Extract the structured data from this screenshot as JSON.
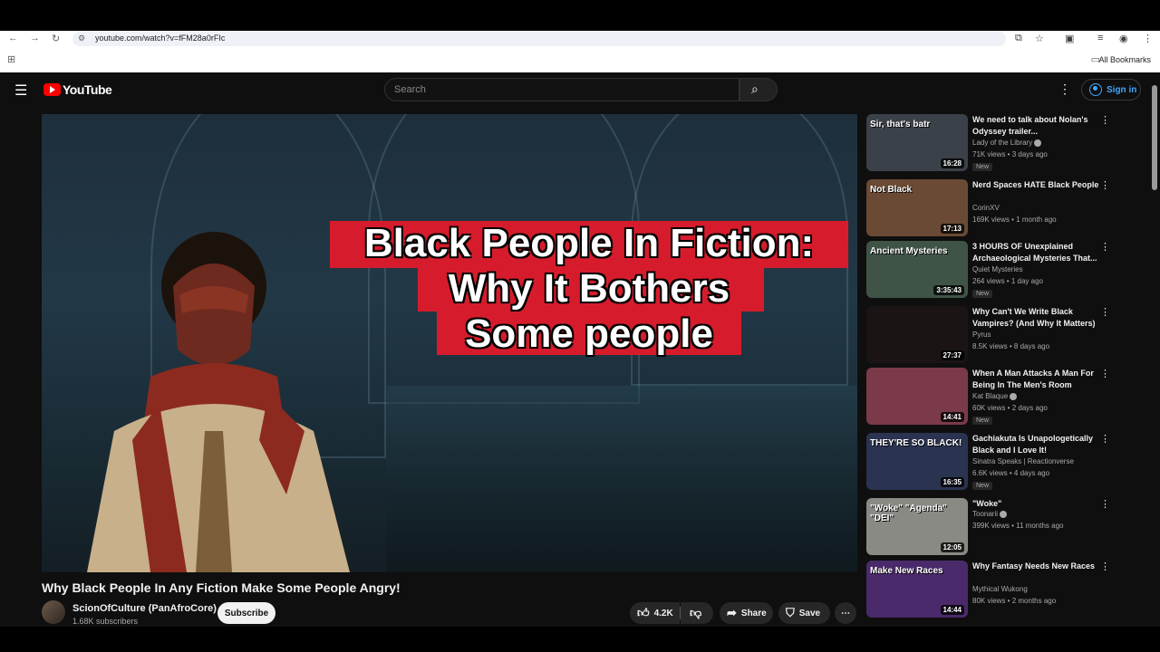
{
  "browser": {
    "url": "youtube.com/watch?v=fFM28a0rFIc",
    "all_bookmarks": "All Bookmarks"
  },
  "header": {
    "logo_text": "YouTube",
    "search_placeholder": "Search",
    "sign_in": "Sign in"
  },
  "player": {
    "title_line1": "Black People In Fiction:",
    "title_line2": "Why It Bothers",
    "title_line3": "Some people"
  },
  "video": {
    "title": "Why Black People In Any Fiction Make Some People Angry!",
    "channel": "ScionOfCulture (PanAfroCore)",
    "subscribers": "1.68K subscribers",
    "subscribe": "Subscribe",
    "likes": "4.2K",
    "share": "Share",
    "save": "Save"
  },
  "recommendations": [
    {
      "title": "We need to talk about Nolan's Odyssey trailer...",
      "channel": "Lady of the Library",
      "verified": true,
      "meta": "71K views • 3 days ago",
      "new": "New",
      "duration": "16:28",
      "thumb_text": "Sir, that's batr",
      "bg": "#3b4148"
    },
    {
      "title": "Nerd Spaces HATE Black People",
      "channel": "CorinXV",
      "verified": false,
      "meta": "169K views • 1 month ago",
      "new": "",
      "duration": "17:13",
      "thumb_text": "Not Black",
      "bg": "#6a4a34"
    },
    {
      "title": "3 HOURS OF Unexplained Archaeological Mysteries That...",
      "channel": "Quiet Mysteries",
      "verified": false,
      "meta": "264 views • 1 day ago",
      "new": "New",
      "duration": "3:35:43",
      "thumb_text": "Ancient Mysteries",
      "bg": "#3f5446"
    },
    {
      "title": "Why Can't We Write Black Vampires? (And Why It Matters)",
      "channel": "Pyrus",
      "verified": false,
      "meta": "8.5K views • 8 days ago",
      "new": "",
      "duration": "27:37",
      "thumb_text": "",
      "bg": "#1a1414"
    },
    {
      "title": "When A Man Attacks A Man For Being In The Men's Room",
      "channel": "Kat Blaque",
      "verified": true,
      "meta": "60K views • 2 days ago",
      "new": "New",
      "duration": "14:41",
      "thumb_text": "",
      "bg": "#7a3a4a"
    },
    {
      "title": "Gachiakuta Is Unapologetically Black and I Love It!",
      "channel": "Sinatra Speaks | Reactionverse",
      "verified": false,
      "meta": "6.6K views • 4 days ago",
      "new": "New",
      "duration": "16:35",
      "thumb_text": "THEY'RE SO BLACK!",
      "bg": "#2a3350"
    },
    {
      "title": "\"Woke\"",
      "channel": "Toonarii",
      "verified": true,
      "meta": "399K views • 11 months ago",
      "new": "",
      "duration": "12:05",
      "thumb_text": "\"Woke\" \"Agenda\" \"DEI\"",
      "bg": "#8a8a84"
    },
    {
      "title": "Why Fantasy Needs New Races",
      "channel": "Mythical Wukong",
      "verified": false,
      "meta": "80K views • 2 months ago",
      "new": "",
      "duration": "14:44",
      "thumb_text": "Make New Races",
      "bg": "#4a2a6a"
    }
  ]
}
